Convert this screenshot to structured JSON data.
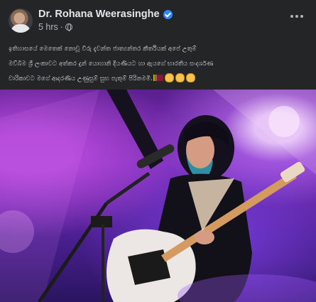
{
  "post": {
    "author": "Dr. Rohana Weerasinghe",
    "time": "5 hrs",
    "separator": "·",
    "caption_lines": [
      "ඉතිහාසයේ මෙතෙක් නොවූ විරු දැවන්ත ජාත්‍යන්තර කීර්තියක් අපේ උතුම්",
      "මව්බිම ශ්‍රී ලංකාවට අත්කර දුන් යොහානි දියණියට හා ඇයගේ භාරතීය සංදර්ශණ",
      "වාරිකාවට මගේ ආදරණිය උණුසුම් සුභ පැතුම් පිරිනමමි."
    ],
    "icons": {
      "verified": "verified-badge-icon",
      "privacy": "globe-icon",
      "menu": "more-options-icon",
      "flag": "sri-lanka-flag-emoji",
      "clap": "clapping-hands-emoji"
    }
  },
  "colors": {
    "background": "#242526",
    "primary_text": "#e4e6eb",
    "secondary_text": "#b0b3b8",
    "verified": "#2d88ff"
  }
}
